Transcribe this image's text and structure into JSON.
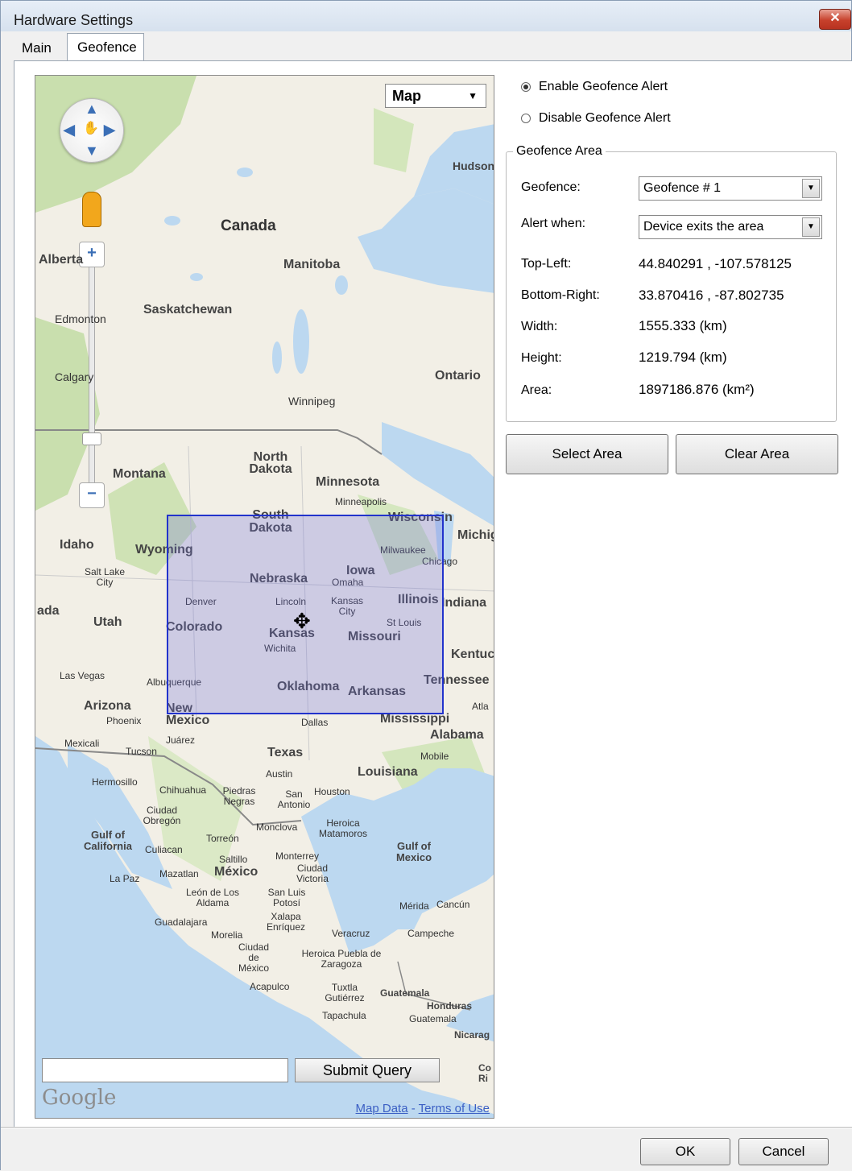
{
  "window": {
    "title": "Hardware Settings",
    "close_glyph": "✕"
  },
  "tabs": [
    {
      "label": "Main"
    },
    {
      "label": "Geofence"
    }
  ],
  "map": {
    "type_label": "Map",
    "type_arrow": "▼",
    "submit_label": "Submit Query",
    "search_value": "",
    "google_logo": "Google",
    "map_data_link": "Map Data",
    "link_sep": " - ",
    "terms_link": "Terms of Use",
    "labels": {
      "hudson": "Hudson Bay",
      "canada": "Canada",
      "alberta": "Alberta",
      "manitoba": "Manitoba",
      "saskatchewan": "Saskatchewan",
      "edmonton": "Edmonton",
      "calgary": "Calgary",
      "ontario": "Ontario",
      "winnipeg": "Winnipeg",
      "montana": "Montana",
      "north_dakota": "North Dakota",
      "minnesota": "Minnesota",
      "minneapolis": "Minneapolis",
      "south_dakota": "South Dakota",
      "wisconsin": "Wisconsin",
      "michigan": "Michig",
      "idaho": "Idaho",
      "wyoming": "Wyoming",
      "milwaukee": "Milwaukee",
      "chicago": "Chicago",
      "salt_lake": "Salt Lake City",
      "nebraska": "Nebraska",
      "omaha": "Omaha",
      "iowa": "Iowa",
      "denver": "Denver",
      "lincoln": "Lincoln",
      "kansas_city": "Kansas City",
      "illinois": "Illinois",
      "indiana": "Indiana",
      "nevada": "ada",
      "utah": "Utah",
      "colorado": "Colorado",
      "kansas": "Kansas",
      "st_louis": "St Louis",
      "missouri": "Missouri",
      "wichita": "Wichita",
      "kentucky": "Kentuc",
      "las_vegas": "Las Vegas",
      "albuquerque": "Albuquerque",
      "oklahoma": "Oklahoma",
      "tennessee": "Tennessee",
      "arkansas": "Arkansas",
      "arizona": "Arizona",
      "new_mexico": "New Mexico",
      "phoenix": "Phoenix",
      "dallas": "Dallas",
      "mississippi": "Mississippi",
      "atlanta": "Atla",
      "alabama": "Alabama",
      "mexicali": "Mexicali",
      "juarez": "Juárez",
      "tucson": "Tucson",
      "texas": "Texas",
      "mobile": "Mobile",
      "austin": "Austin",
      "louisiana": "Louisiana",
      "hermosillo": "Hermosillo",
      "chihuahua": "Chihuahua",
      "piedras_negras": "Piedras Negras",
      "san_antonio": "San Antonio",
      "houston": "Houston",
      "ciudad_obregon": "Ciudad Obregón",
      "monclova": "Monclova",
      "heroica_matamoros": "Heroica Matamoros",
      "gulf_of_california": "Gulf of California",
      "torreon": "Torreón",
      "culiacan": "Culiacan",
      "saltillo": "Saltillo",
      "monterrey": "Monterrey",
      "gulf_of_mexico": "Gulf of Mexico",
      "la_paz": "La Paz",
      "mazatlan": "Mazatlan",
      "mexico": "México",
      "ciudad_victoria": "Ciudad Victoria",
      "leon": "León de Los Aldama",
      "san_luis": "San Luis Potosí",
      "merida": "Mérida",
      "cancun": "Cancún",
      "guadalajara": "Guadalajara",
      "xalapa": "Xalapa Enríquez",
      "morelia": "Morelia",
      "veracruz": "Veracruz",
      "campeche": "Campeche",
      "ciudad_mexico": "Ciudad de México",
      "puebla": "Heroica Puebla de Zaragoza",
      "acapulco": "Acapulco",
      "tuxtla": "Tuxtla Gutiérrez",
      "guatemala": "Guatemala",
      "honduras": "Honduras",
      "tapachula": "Tapachula",
      "guatemala_city": "Guatemala",
      "nicaragua": "Nicarag",
      "costa_rica": "Co Ri"
    }
  },
  "alert": {
    "enable_label": "Enable Geofence Alert",
    "disable_label": "Disable Geofence Alert",
    "selected": "enable"
  },
  "geofence_area": {
    "title": "Geofence Area",
    "geofence_label": "Geofence:",
    "geofence_value": "Geofence # 1",
    "alert_when_label": "Alert when:",
    "alert_when_value": "Device exits the area",
    "top_left_label": "Top-Left:",
    "top_left_value": "44.840291 , -107.578125",
    "bottom_right_label": "Bottom-Right:",
    "bottom_right_value": "33.870416 , -87.802735",
    "width_label": "Width:",
    "width_value": "1555.333 (km)",
    "height_label": "Height:",
    "height_value": "1219.794 (km)",
    "area_label": "Area:",
    "area_value": "1897186.876 (km²)"
  },
  "buttons": {
    "select_area": "Select Area",
    "clear_area": "Clear Area",
    "ok": "OK",
    "cancel": "Cancel"
  },
  "colors": {
    "selection_fill": "#6e6edc",
    "selection_border": "#2233cc",
    "water": "#bcd8f0",
    "land": "#f2efe6",
    "forest": "#c9dfae"
  }
}
